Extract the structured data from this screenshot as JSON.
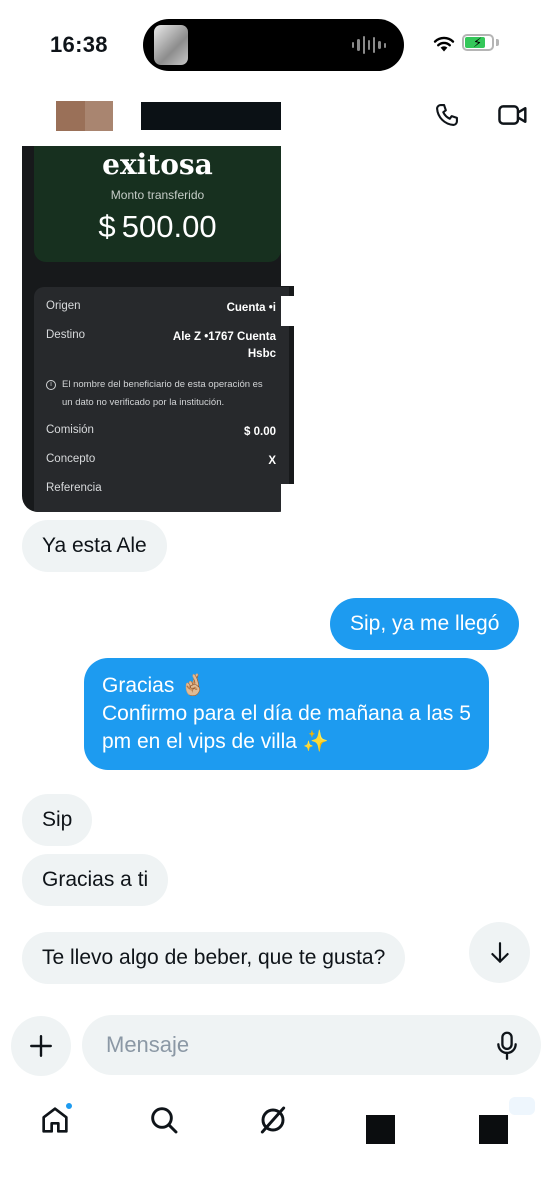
{
  "status_bar": {
    "time": "16:38",
    "battery_level": 0.7,
    "icons": [
      "thumbnail-icon",
      "waveform-icon",
      "wifi-icon",
      "battery-charging-icon"
    ]
  },
  "header": {
    "avatar_colors": [
      "#9a7058",
      "#a98570"
    ],
    "icons": [
      "phone-icon",
      "video-call-icon"
    ]
  },
  "transfer_card": {
    "title": "exitosa",
    "subtitle": "Monto transferido",
    "amount": "$ 500.00",
    "rows": [
      {
        "label": "Origen",
        "value": "Cuenta •​i"
      },
      {
        "label": "Destino",
        "value": "Ale Z •1767 Cuenta\nHsbc"
      },
      {
        "label": "Comisión",
        "value": "$ 0.00"
      },
      {
        "label": "Concepto",
        "value": "X"
      },
      {
        "label": "Referencia",
        "value": ""
      }
    ],
    "note": "El nombre del beneficiario de esta operación es un dato no verificado por la institución.",
    "colors": {
      "card": "#17191b",
      "accent_green": "#17301f",
      "details": "#27292c"
    }
  },
  "messages": [
    {
      "side": "in",
      "text": "Ya esta Ale"
    },
    {
      "side": "out",
      "text": "Sip, ya me llegó"
    },
    {
      "side": "out",
      "text": "Gracias 🤞🏼\nConfirmo para el día de mañana a las 5\npm en el vips de villa ✨"
    },
    {
      "side": "in",
      "text": "Sip"
    },
    {
      "side": "in",
      "text": "Gracias a ti"
    },
    {
      "side": "in",
      "text": "Te llevo algo de beber, que te gusta?"
    }
  ],
  "composer": {
    "placeholder": "Mensaje",
    "value": "",
    "icons": [
      "plus-icon",
      "microphone-icon",
      "arrow-down-icon"
    ]
  },
  "bottom_nav": {
    "items": [
      "home-icon",
      "search-icon",
      "grok-icon",
      "redacted",
      "redacted"
    ],
    "home_badge": true
  },
  "colors": {
    "outgoing_bubble": "#1d9bf0",
    "incoming_bubble": "#eff3f4",
    "text": "#0f1419",
    "placeholder": "#8b98a5"
  }
}
